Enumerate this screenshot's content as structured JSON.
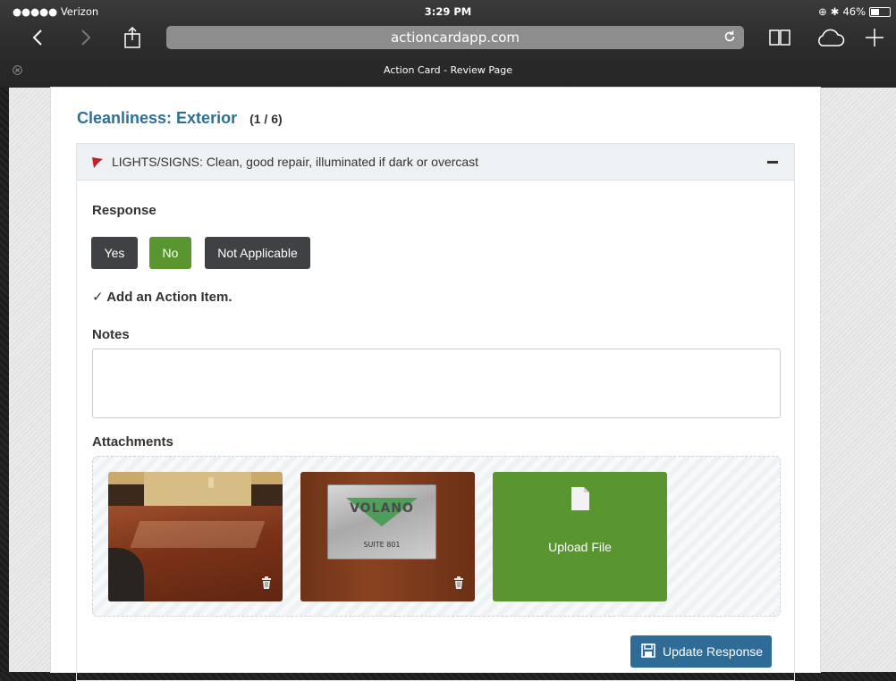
{
  "status_bar": {
    "carrier": "●●●●● Verizon",
    "time": "3:29 PM",
    "battery": "46%",
    "battery_level": 0.46
  },
  "browser": {
    "url": "actioncardapp.com",
    "tab_title": "Action Card - Review Page",
    "icons": [
      "back-icon",
      "forward-icon",
      "share-icon",
      "reload-icon",
      "bookmarks-icon",
      "cloud-tabs-icon",
      "new-tab-icon",
      "close-tab-icon"
    ]
  },
  "section": {
    "title": "Cleanliness: Exterior",
    "count": "(1 / 6)"
  },
  "question": {
    "text": "LIGHTS/SIGNS: Clean, good repair, illuminated if dark or overcast",
    "flag_color": "#c0202a"
  },
  "response": {
    "label": "Response",
    "options": [
      "Yes",
      "No",
      "Not Applicable"
    ],
    "selected": "No"
  },
  "action_item": {
    "label": "Add an Action Item."
  },
  "notes": {
    "label": "Notes",
    "value": ""
  },
  "attachments": {
    "label": "Attachments",
    "items": [
      {
        "type": "photo",
        "subject": "wooden table"
      },
      {
        "type": "photo",
        "subject": "office sign",
        "brand_text": "VOLANO",
        "suite_text": "SUITE 801"
      }
    ],
    "upload_label": "Upload File"
  },
  "update_button": {
    "label": "Update Response"
  },
  "colors": {
    "accent_blue": "#2f6f95",
    "green": "#5a9630",
    "dark_button": "#3f4144",
    "update_blue": "#2e6b96"
  }
}
